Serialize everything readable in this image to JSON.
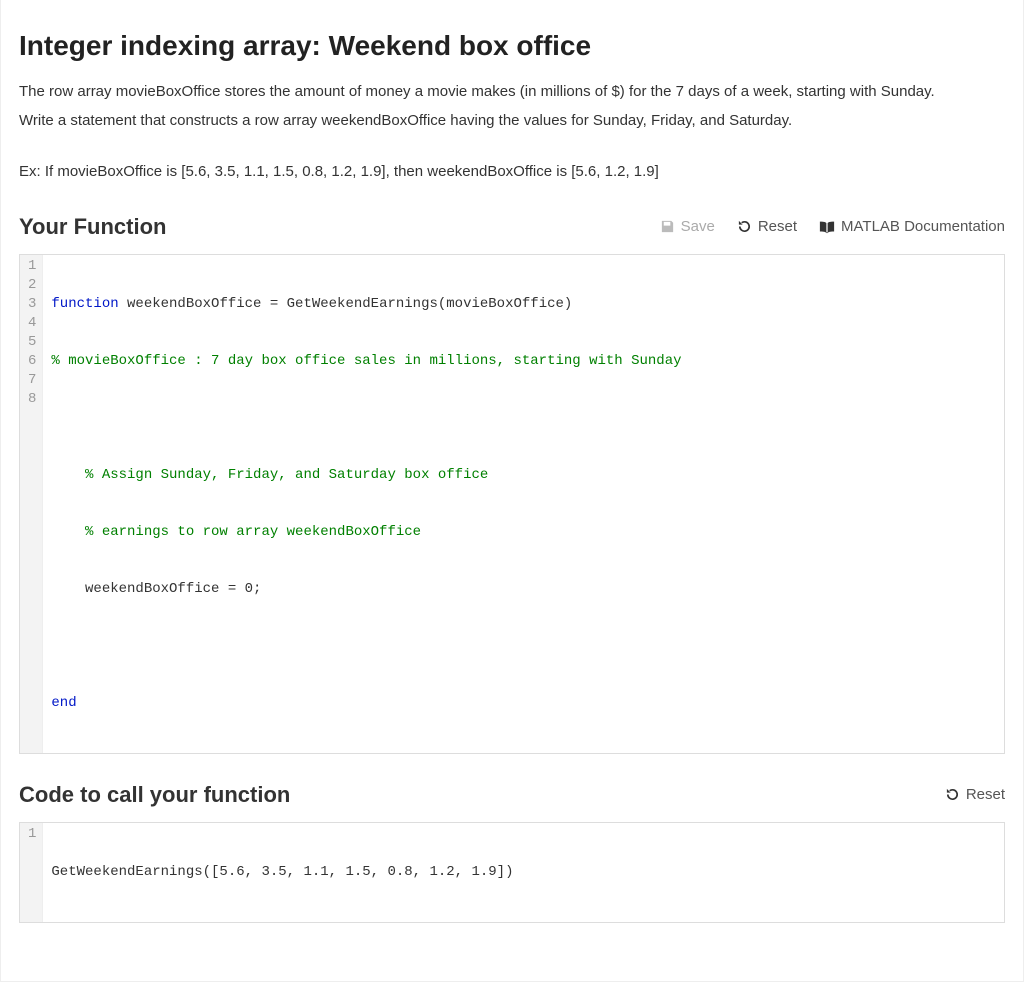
{
  "heading": "Integer indexing array: Weekend box office",
  "description1": "The row array movieBoxOffice stores the amount of money a movie makes (in millions of $) for the 7 days of a week, starting with Sunday.",
  "description2": "Write a statement that constructs a row array weekendBoxOffice having the values for Sunday, Friday, and Saturday.",
  "example": "Ex: If movieBoxOffice is [5.6, 3.5, 1.1, 1.5, 0.8, 1.2, 1.9], then weekendBoxOffice is [5.6, 1.2, 1.9]",
  "yourFunction": {
    "title": "Your Function",
    "toolbar": {
      "save": "Save",
      "reset": "Reset",
      "docs": "MATLAB Documentation"
    },
    "lines": {
      "1": {
        "kw": "function",
        "rest": " weekendBoxOffice = GetWeekendEarnings(movieBoxOffice)"
      },
      "2": {
        "cm": "% movieBoxOffice : 7 day box office sales in millions, starting with Sunday"
      },
      "3": {
        "text": ""
      },
      "4": {
        "cm": "    % Assign Sunday, Friday, and Saturday box office"
      },
      "5": {
        "cm": "    % earnings to row array weekendBoxOffice"
      },
      "6": {
        "text": "    weekendBoxOffice = 0;"
      },
      "7": {
        "text": ""
      },
      "8": {
        "kw": "end"
      }
    }
  },
  "callSection": {
    "title": "Code to call your function",
    "reset": "Reset",
    "lines": {
      "1": {
        "text": "GetWeekendEarnings([5.6, 3.5, 1.1, 1.5, 0.8, 1.2, 1.9])"
      }
    }
  }
}
